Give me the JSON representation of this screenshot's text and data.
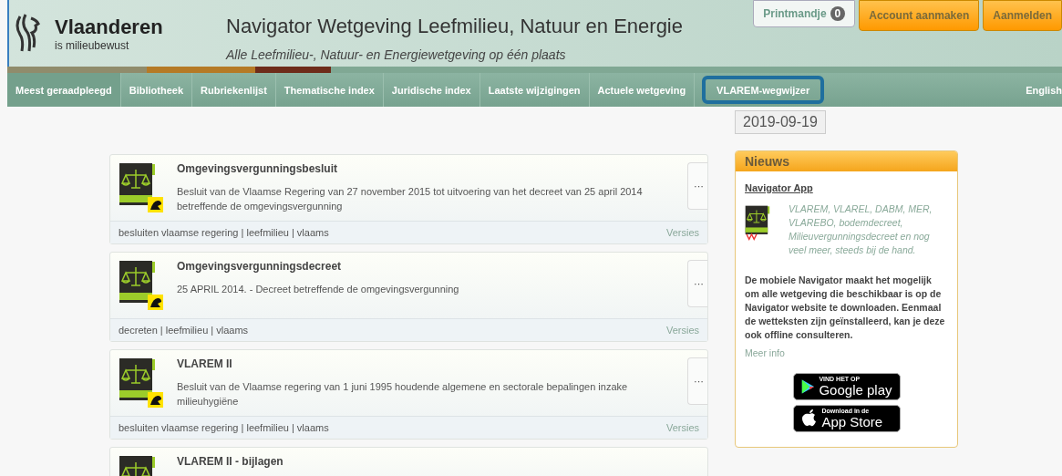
{
  "header": {
    "logo_name": "Vlaanderen",
    "logo_tagline": "is milieubewust",
    "title": "Navigator Wetgeving Leefmilieu, Natuur en Energie",
    "subtitle": "Alle Leefmilieu-, Natuur- en Energiewetgeving op één plaats",
    "actions": [
      {
        "kind": "cart",
        "label": "Printmandje",
        "count": "0"
      },
      {
        "kind": "primary",
        "label": "Account aanmaken"
      },
      {
        "kind": "primary",
        "label": "Aanmelden"
      }
    ]
  },
  "nav": {
    "items": [
      {
        "label": "Meest geraadpleegd",
        "selected": true,
        "highlighted": false
      },
      {
        "label": "Bibliotheek",
        "selected": false,
        "highlighted": false
      },
      {
        "label": "Rubriekenlijst",
        "selected": false,
        "highlighted": false
      },
      {
        "label": "Thematische index",
        "selected": false,
        "highlighted": false
      },
      {
        "label": "Juridische index",
        "selected": false,
        "highlighted": false
      },
      {
        "label": "Laatste wijzigingen",
        "selected": false,
        "highlighted": false
      },
      {
        "label": "Actuele wetgeving",
        "selected": false,
        "highlighted": false
      },
      {
        "label": "VLAREM-wegwijzer",
        "selected": false,
        "highlighted": true
      }
    ],
    "language": "English"
  },
  "documents": [
    {
      "title": "Omgevingsvergunningsbesluit",
      "description": "Besluit van de Vlaamse Regering van 27 november 2015 tot uitvoering van het decreet van 25 april 2014 betreffende de omgevingsvergunning",
      "menu": "···",
      "tags": "besluiten vlaamse regering | leefmilieu | vlaams",
      "versions": "Versies"
    },
    {
      "title": "Omgevingsvergunningsdecreet",
      "description": "25 APRIL 2014. - Decreet betreffende de omgevingsvergunning",
      "menu": "···",
      "tags": "decreten | leefmilieu | vlaams",
      "versions": "Versies"
    },
    {
      "title": "VLAREM II",
      "description": "Besluit van de Vlaamse regering van 1 juni 1995 houdende algemene en sectorale bepalingen inzake milieuhygiëne",
      "menu": "···",
      "tags": "besluiten vlaamse regering | leefmilieu | vlaams",
      "versions": "Versies"
    },
    {
      "title": "VLAREM II - bijlagen"
    }
  ],
  "sidebar": {
    "date": "2019-09-19",
    "news": {
      "heading": "Nieuws",
      "link": "Navigator App",
      "teaser": "VLAREM, VLAREL, DABM, MER, VLAREBO, bodemdecreet, Milieuvergunningsdecreet en nog veel meer, steeds bij de hand.",
      "body": "De mobiele Navigator maakt het mogelijk om alle wetgeving die beschikbaar is op de Navigator website te downloaden. Eenmaal de wetteksten zijn geïnstalleerd, kan je deze ook offline consulteren.",
      "more": "Meer info",
      "badges": [
        {
          "kind": "google",
          "small": "VIND HET OP",
          "big": "Google play"
        },
        {
          "kind": "apple",
          "small": "Download in de",
          "big": "App Store"
        }
      ]
    }
  }
}
